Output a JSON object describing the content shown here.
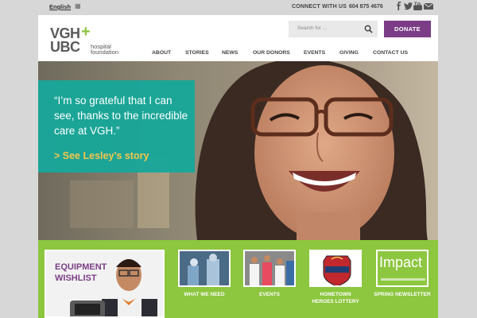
{
  "topbar": {
    "language": "English",
    "connect": "CONNECT WITH US",
    "phone": "604 875 4676"
  },
  "logo": {
    "line1": "VGH",
    "line2": "UBC",
    "text1": "hospital",
    "text2": "foundation"
  },
  "search": {
    "placeholder": "Search for ..."
  },
  "donate": {
    "label": "DONATE"
  },
  "nav": [
    "ABOUT",
    "STORIES",
    "NEWS",
    "OUR DONORS",
    "EVENTS",
    "GIVING",
    "CONTACT US"
  ],
  "hero": {
    "quote": "“I’m so grateful that I can see, thanks to the incredible care at VGH.”",
    "link": "> See Lesley’s story"
  },
  "features": {
    "wishlist_line1": "EQUIPMENT",
    "wishlist_line2": "WISHLIST",
    "tiles": [
      "WHAT WE NEED",
      "EVENTS",
      "HOMETOWN",
      "HEROES LOTTERY",
      "SPRING NEWSLETTER"
    ],
    "impact_title": "Impact"
  },
  "colors": {
    "green": "#8dc63f",
    "purple": "#7b3d86",
    "teal": "#16a89a",
    "gold": "#f4c54c"
  }
}
